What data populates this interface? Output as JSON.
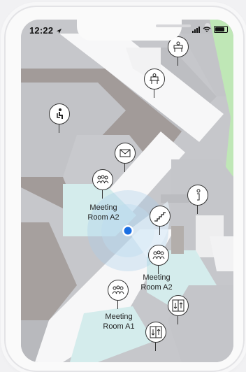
{
  "status": {
    "time": "12:22",
    "location_icon": "location-arrow-icon",
    "signal_icon": "signal-icon",
    "wifi_icon": "wifi-icon",
    "battery_icon": "battery-icon"
  },
  "map": {
    "labels": {
      "room_a2_top_line1": "Meeting",
      "room_a2_top_line2": "Room A2",
      "room_a2_bottom_line1": "Meeting",
      "room_a2_bottom_line2": "Room A2",
      "room_a1_line1": "Meeting",
      "room_a1_line2": "Room A1"
    },
    "pins": [
      {
        "name": "seating-icon"
      },
      {
        "name": "mail-icon"
      },
      {
        "name": "meeting-room-icon"
      },
      {
        "name": "info-icon"
      },
      {
        "name": "stairs-icon"
      },
      {
        "name": "desk-icon"
      },
      {
        "name": "elevator-icon"
      }
    ],
    "colors": {
      "floor": "#d3d4d8",
      "room_gray": "#bfc1c6",
      "room_dark": "#a19a98",
      "room_teal": "#d6eeee",
      "corridor": "#f8f8f8",
      "green": "#bfe7b6",
      "location_dot": "#1b6fe2"
    }
  }
}
